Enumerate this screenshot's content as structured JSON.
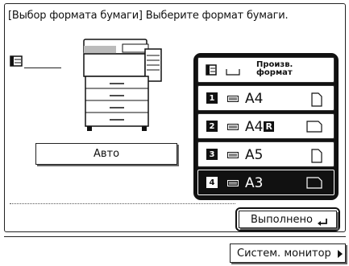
{
  "header": {
    "title": "[Выбор формата бумаги] Выберите формат бумаги."
  },
  "left": {
    "auto_label": "Авто"
  },
  "paper_options": [
    {
      "id": "mp",
      "label_line1": "Произв.",
      "label_line2": "формат"
    },
    {
      "id": "1",
      "number": "1",
      "size": "A4",
      "orientation": "portrait",
      "selected": false
    },
    {
      "id": "2",
      "number": "2",
      "size": "A4",
      "suffix": "R",
      "orientation": "landscape",
      "selected": false
    },
    {
      "id": "3",
      "number": "3",
      "size": "A5",
      "orientation": "portrait",
      "selected": false
    },
    {
      "id": "4",
      "number": "4",
      "size": "A3",
      "orientation": "landscape",
      "selected": true
    }
  ],
  "actions": {
    "done_label": "Выполнено"
  },
  "status": {
    "monitor_label": "Систем. монитор"
  },
  "colors": {
    "selected_bg": "#111111",
    "background": "#ffffff"
  }
}
